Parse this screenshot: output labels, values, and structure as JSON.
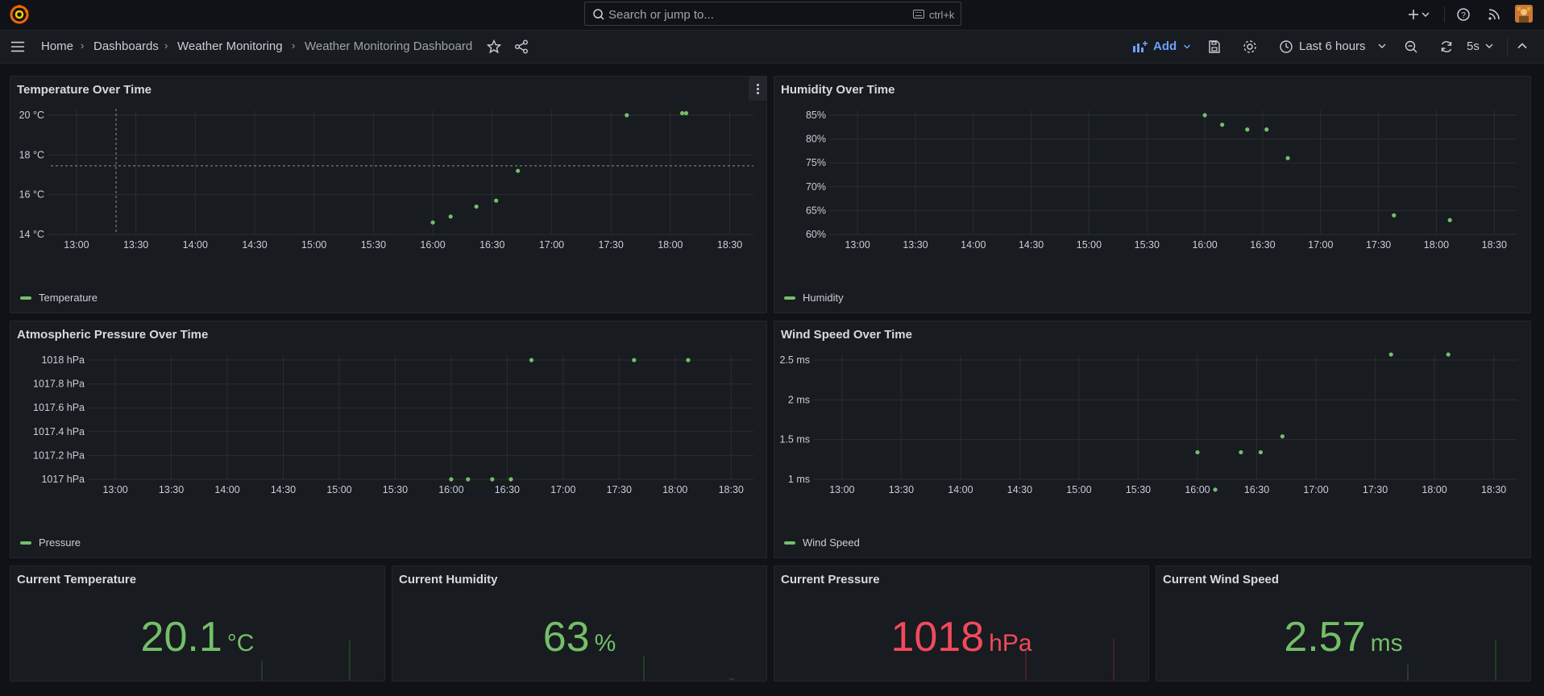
{
  "topbar": {
    "search_placeholder": "Search or jump to...",
    "search_shortcut": "ctrl+k"
  },
  "breadcrumb": {
    "items": [
      "Home",
      "Dashboards",
      "Weather Monitoring",
      "Weather Monitoring Dashboard"
    ]
  },
  "toolbar": {
    "add_label": "Add",
    "time_range": "Last 6 hours",
    "refresh_interval": "5s"
  },
  "colors": {
    "series": "#73bf69",
    "red": "#f2495c",
    "accent": "#6e9fff"
  },
  "panels": {
    "temperature": {
      "title": "Temperature Over Time",
      "legend": "Temperature"
    },
    "humidity": {
      "title": "Humidity Over Time",
      "legend": "Humidity"
    },
    "pressure": {
      "title": "Atmospheric Pressure Over Time",
      "legend": "Pressure"
    },
    "wind": {
      "title": "Wind Speed Over Time",
      "legend": "Wind Speed"
    }
  },
  "stats": {
    "temperature": {
      "title": "Current Temperature",
      "value": "20.1",
      "unit": "°C",
      "color": "#73bf69"
    },
    "humidity": {
      "title": "Current Humidity",
      "value": "63",
      "unit": "%",
      "color": "#73bf69"
    },
    "pressure": {
      "title": "Current Pressure",
      "value": "1018",
      "unit": "hPa",
      "color": "#f2495c"
    },
    "wind": {
      "title": "Current Wind Speed",
      "value": "2.57",
      "unit": "ms",
      "color": "#73bf69"
    }
  },
  "chart_data": [
    {
      "type": "scatter",
      "title": "Temperature Over Time",
      "x_ticks": [
        "13:00",
        "13:30",
        "14:00",
        "14:30",
        "15:00",
        "15:30",
        "16:00",
        "16:30",
        "17:00",
        "17:30",
        "18:00",
        "18:30"
      ],
      "y_ticks": [
        "14 °C",
        "16 °C",
        "18 °C",
        "20 °C"
      ],
      "ylim": [
        14,
        20
      ],
      "xlim": [
        "12:47",
        "18:42"
      ],
      "series": [
        {
          "name": "Temperature",
          "x": [
            "16:00",
            "16:09",
            "16:22",
            "16:32",
            "16:43",
            "17:38",
            "18:06",
            "18:08"
          ],
          "y": [
            14.6,
            14.9,
            15.4,
            15.7,
            17.2,
            20.0,
            20.1,
            20.1
          ]
        }
      ]
    },
    {
      "type": "scatter",
      "title": "Humidity Over Time",
      "x_ticks": [
        "13:00",
        "13:30",
        "14:00",
        "14:30",
        "15:00",
        "15:30",
        "16:00",
        "16:30",
        "17:00",
        "17:30",
        "18:00",
        "18:30"
      ],
      "y_ticks": [
        "60%",
        "65%",
        "70%",
        "75%",
        "80%",
        "85%"
      ],
      "ylim": [
        60,
        85
      ],
      "xlim": [
        "12:47",
        "18:42"
      ],
      "series": [
        {
          "name": "Humidity",
          "x": [
            "16:00",
            "16:09",
            "16:22",
            "16:32",
            "16:43",
            "17:38",
            "18:07"
          ],
          "y": [
            85,
            83,
            82,
            82,
            76,
            64,
            63
          ]
        }
      ]
    },
    {
      "type": "scatter",
      "title": "Atmospheric Pressure Over Time",
      "x_ticks": [
        "13:00",
        "13:30",
        "14:00",
        "14:30",
        "15:00",
        "15:30",
        "16:00",
        "16:30",
        "17:00",
        "17:30",
        "18:00",
        "18:30"
      ],
      "y_ticks": [
        "1017 hPa",
        "1017.2 hPa",
        "1017.4 hPa",
        "1017.6 hPa",
        "1017.8 hPa",
        "1018 hPa"
      ],
      "ylim": [
        1017,
        1018
      ],
      "xlim": [
        "12:47",
        "18:42"
      ],
      "series": [
        {
          "name": "Pressure",
          "x": [
            "16:00",
            "16:09",
            "16:22",
            "16:32",
            "16:43",
            "17:38",
            "18:07"
          ],
          "y": [
            1017,
            1017,
            1017,
            1017,
            1018,
            1018,
            1018
          ]
        }
      ]
    },
    {
      "type": "scatter",
      "title": "Wind Speed Over Time",
      "x_ticks": [
        "13:00",
        "13:30",
        "14:00",
        "14:30",
        "15:00",
        "15:30",
        "16:00",
        "16:30",
        "17:00",
        "17:30",
        "18:00",
        "18:30"
      ],
      "y_ticks": [
        "1 ms",
        "1.5 ms",
        "2 ms",
        "2.5 ms"
      ],
      "ylim": [
        1,
        2.5
      ],
      "xlim": [
        "12:47",
        "18:42"
      ],
      "series": [
        {
          "name": "Wind Speed",
          "x": [
            "16:00",
            "16:09",
            "16:22",
            "16:32",
            "16:43",
            "17:38",
            "18:07"
          ],
          "y": [
            1.34,
            0.87,
            1.34,
            1.34,
            1.54,
            2.57,
            2.57
          ]
        }
      ]
    }
  ]
}
